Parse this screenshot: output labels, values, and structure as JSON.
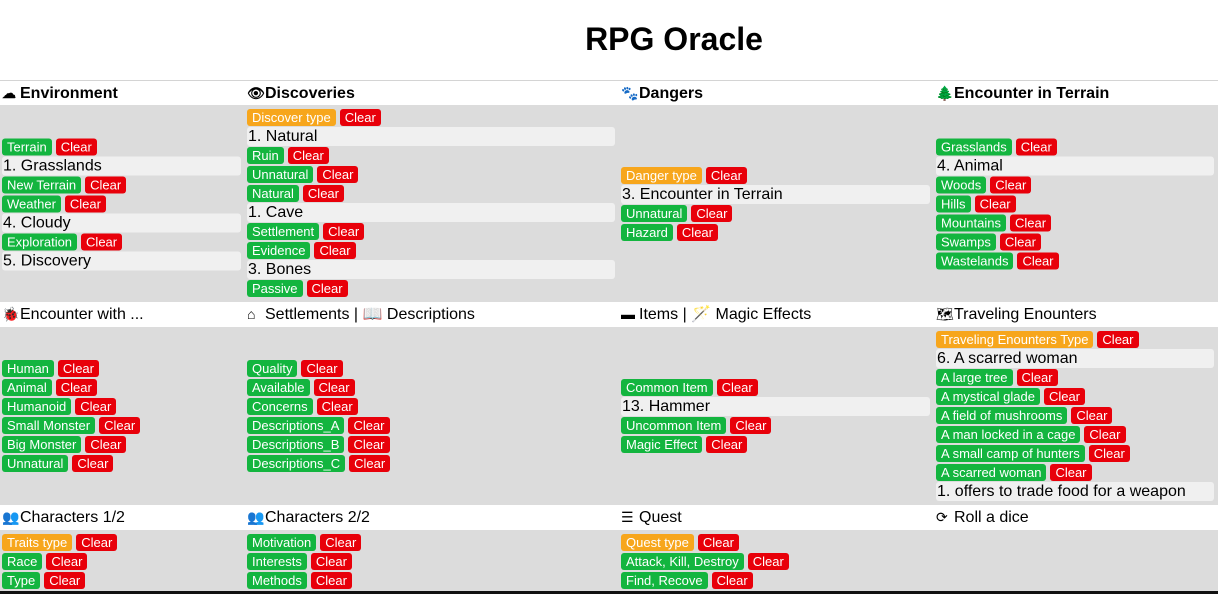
{
  "app_title": "RPG Oracle",
  "clear_label": "Clear",
  "rows": [
    {
      "cells": [
        {
          "header": "Environment",
          "icon": "cloud-icon",
          "glyph": "☁",
          "bold": true,
          "align": "center",
          "items": [
            {
              "k": "btn",
              "label": "Terrain",
              "color": "green"
            },
            {
              "k": "res",
              "text": "1. Grasslands"
            },
            {
              "k": "btn",
              "label": "New Terrain",
              "color": "green"
            },
            {
              "k": "btn",
              "label": "Weather",
              "color": "green"
            },
            {
              "k": "res",
              "text": "4. Cloudy"
            },
            {
              "k": "btn",
              "label": "Exploration",
              "color": "green"
            },
            {
              "k": "res",
              "text": "5. Discovery"
            }
          ]
        },
        {
          "header": "Discoveries",
          "icon": "eye-icon",
          "glyph": "👁",
          "bold": true,
          "align": "top",
          "items": [
            {
              "k": "btn",
              "label": "Discover type",
              "color": "orange"
            },
            {
              "k": "res",
              "text": "1. Natural"
            },
            {
              "k": "btn",
              "label": "Ruin",
              "color": "green"
            },
            {
              "k": "btn",
              "label": "Unnatural",
              "color": "green"
            },
            {
              "k": "btn",
              "label": "Natural",
              "color": "green"
            },
            {
              "k": "res",
              "text": "1. Cave"
            },
            {
              "k": "btn",
              "label": "Settlement",
              "color": "green"
            },
            {
              "k": "btn",
              "label": "Evidence",
              "color": "green"
            },
            {
              "k": "res",
              "text": "3. Bones"
            },
            {
              "k": "btn",
              "label": "Passive",
              "color": "green"
            }
          ]
        },
        {
          "header": "Dangers",
          "icon": "paw-icon",
          "glyph": "🐾",
          "bold": true,
          "align": "center",
          "items": [
            {
              "k": "btn",
              "label": "Danger type",
              "color": "orange"
            },
            {
              "k": "res",
              "text": "3. Encounter in Terrain"
            },
            {
              "k": "btn",
              "label": "Unnatural",
              "color": "green"
            },
            {
              "k": "btn",
              "label": "Hazard",
              "color": "green"
            }
          ]
        },
        {
          "header": "Encounter in Terrain",
          "icon": "tree-icon",
          "glyph": "🌲",
          "bold": true,
          "align": "center",
          "items": [
            {
              "k": "btn",
              "label": "Grasslands",
              "color": "green"
            },
            {
              "k": "res",
              "text": "4. Animal"
            },
            {
              "k": "btn",
              "label": "Woods",
              "color": "green"
            },
            {
              "k": "btn",
              "label": "Hills",
              "color": "green"
            },
            {
              "k": "btn",
              "label": "Mountains",
              "color": "green"
            },
            {
              "k": "btn",
              "label": "Swamps",
              "color": "green"
            },
            {
              "k": "btn",
              "label": "Wastelands",
              "color": "green"
            }
          ]
        }
      ]
    },
    {
      "cells": [
        {
          "header": "Encounter with ...",
          "icon": "bug-icon",
          "glyph": "🐞",
          "bold": false,
          "align": "center",
          "items": [
            {
              "k": "btn",
              "label": "Human",
              "color": "green"
            },
            {
              "k": "btn",
              "label": "Animal",
              "color": "green"
            },
            {
              "k": "btn",
              "label": "Humanoid",
              "color": "green"
            },
            {
              "k": "btn",
              "label": "Small Monster",
              "color": "green"
            },
            {
              "k": "btn",
              "label": "Big Monster",
              "color": "green"
            },
            {
              "k": "btn",
              "label": "Unnatural",
              "color": "green"
            }
          ]
        },
        {
          "header": "Settlements | 📖 Descriptions",
          "icon": "home-icon",
          "glyph": "⌂",
          "bold": false,
          "align": "center",
          "items": [
            {
              "k": "btn",
              "label": "Quality",
              "color": "green"
            },
            {
              "k": "btn",
              "label": "Available",
              "color": "green"
            },
            {
              "k": "btn",
              "label": "Concerns",
              "color": "green"
            },
            {
              "k": "btn",
              "label": "Descriptions_A",
              "color": "green"
            },
            {
              "k": "btn",
              "label": "Descriptions_B",
              "color": "green"
            },
            {
              "k": "btn",
              "label": "Descriptions_C",
              "color": "green"
            }
          ]
        },
        {
          "header": "Items | 🪄 Magic Effects",
          "icon": "archive-icon",
          "glyph": "▬",
          "bold": false,
          "align": "center",
          "items": [
            {
              "k": "btn",
              "label": "Common Item",
              "color": "green"
            },
            {
              "k": "res",
              "text": "13. Hammer"
            },
            {
              "k": "btn",
              "label": "Uncommon Item",
              "color": "green"
            },
            {
              "k": "btn",
              "label": "Magic Effect",
              "color": "green"
            }
          ]
        },
        {
          "header": "Traveling Enounters",
          "icon": "map-icon",
          "glyph": "🗺",
          "bold": false,
          "align": "top",
          "items": [
            {
              "k": "btn",
              "label": "Traveling Enounters Type",
              "color": "orange"
            },
            {
              "k": "res",
              "text": "6. A scarred woman"
            },
            {
              "k": "btn",
              "label": "A large tree",
              "color": "green"
            },
            {
              "k": "btn",
              "label": "A mystical glade",
              "color": "green"
            },
            {
              "k": "btn",
              "label": "A field of mushrooms",
              "color": "green"
            },
            {
              "k": "btn",
              "label": "A man locked in a cage",
              "color": "green"
            },
            {
              "k": "btn",
              "label": "A small camp of hunters",
              "color": "green"
            },
            {
              "k": "btn",
              "label": "A scarred woman",
              "color": "green"
            },
            {
              "k": "res",
              "text": "1. offers to trade food for a weapon"
            }
          ]
        }
      ]
    },
    {
      "cells": [
        {
          "header": "Characters 1/2",
          "icon": "users-icon",
          "glyph": "👥",
          "bold": false,
          "align": "top",
          "items": [
            {
              "k": "btn",
              "label": "Traits type",
              "color": "orange"
            },
            {
              "k": "btn",
              "label": "Race",
              "color": "green"
            },
            {
              "k": "btn",
              "label": "Type",
              "color": "green"
            }
          ]
        },
        {
          "header": "Characters 2/2",
          "icon": "users-icon",
          "glyph": "👥",
          "bold": false,
          "align": "top",
          "items": [
            {
              "k": "btn",
              "label": "Motivation",
              "color": "green"
            },
            {
              "k": "btn",
              "label": "Interests",
              "color": "green"
            },
            {
              "k": "btn",
              "label": "Methods",
              "color": "green"
            }
          ]
        },
        {
          "header": "Quest",
          "icon": "list-icon",
          "glyph": "☰",
          "bold": false,
          "align": "top",
          "items": [
            {
              "k": "btn",
              "label": "Quest type",
              "color": "orange"
            },
            {
              "k": "btn",
              "label": "Attack, Kill, Destroy",
              "color": "green"
            },
            {
              "k": "btn",
              "label": "Find, Recove",
              "color": "green"
            }
          ]
        },
        {
          "header": "Roll a dice",
          "icon": "refresh-icon",
          "glyph": "⟳",
          "bold": false,
          "align": "top",
          "items": []
        }
      ]
    }
  ]
}
